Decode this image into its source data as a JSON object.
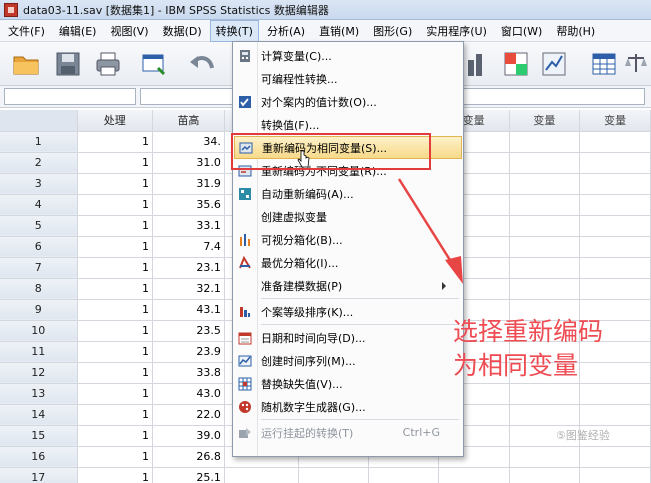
{
  "window": {
    "title": "data03-11.sav [数据集1] - IBM SPSS Statistics 数据编辑器"
  },
  "menubar": [
    {
      "label": "文件(F)",
      "name": "menu-file"
    },
    {
      "label": "编辑(E)",
      "name": "menu-edit"
    },
    {
      "label": "视图(V)",
      "name": "menu-view"
    },
    {
      "label": "数据(D)",
      "name": "menu-data"
    },
    {
      "label": "转换(T)",
      "name": "menu-transform",
      "active": true
    },
    {
      "label": "分析(A)",
      "name": "menu-analyze"
    },
    {
      "label": "直销(M)",
      "name": "menu-direct-marketing"
    },
    {
      "label": "图形(G)",
      "name": "menu-graphs"
    },
    {
      "label": "实用程序(U)",
      "name": "menu-utilities"
    },
    {
      "label": "窗口(W)",
      "name": "menu-window"
    },
    {
      "label": "帮助(H)",
      "name": "menu-help"
    }
  ],
  "toolbar_icons": [
    "open-folder-icon",
    "save-icon",
    "print-icon",
    "dialog-recall-icon",
    "undo-icon",
    "chart-icon",
    "split-file-icon",
    "select-cases-icon",
    "value-labels-icon",
    "weight-cases-icon"
  ],
  "grid": {
    "columns": [
      "",
      "处理",
      "苗高",
      "",
      "",
      "",
      "变量",
      "变量",
      "变量"
    ],
    "rows": [
      {
        "n": "1",
        "a": "1",
        "b": "34."
      },
      {
        "n": "2",
        "a": "1",
        "b": "31.0"
      },
      {
        "n": "3",
        "a": "1",
        "b": "31.9"
      },
      {
        "n": "4",
        "a": "1",
        "b": "35.6"
      },
      {
        "n": "5",
        "a": "1",
        "b": "33.1"
      },
      {
        "n": "6",
        "a": "1",
        "b": "7.4"
      },
      {
        "n": "7",
        "a": "1",
        "b": "23.1"
      },
      {
        "n": "8",
        "a": "1",
        "b": "32.1"
      },
      {
        "n": "9",
        "a": "1",
        "b": "43.1"
      },
      {
        "n": "10",
        "a": "1",
        "b": "23.5"
      },
      {
        "n": "11",
        "a": "1",
        "b": "23.9"
      },
      {
        "n": "12",
        "a": "1",
        "b": "33.8"
      },
      {
        "n": "13",
        "a": "1",
        "b": "43.0"
      },
      {
        "n": "14",
        "a": "1",
        "b": "22.0"
      },
      {
        "n": "15",
        "a": "1",
        "b": "39.0"
      },
      {
        "n": "16",
        "a": "1",
        "b": "26.8"
      },
      {
        "n": "17",
        "a": "1",
        "b": "25.1"
      }
    ]
  },
  "transform_menu": {
    "items": [
      {
        "label": "计算变量(C)...",
        "icon": "calculator-icon",
        "name": "menu-compute-variable"
      },
      {
        "label": "可编程性转换...",
        "icon": "",
        "name": "menu-programmability-transform"
      },
      {
        "label": "对个案内的值计数(O)...",
        "icon": "count-values-icon",
        "name": "menu-count-values"
      },
      {
        "label": "转换值(F)...",
        "icon": "",
        "name": "menu-shift-values"
      },
      {
        "label": "重新编码为相同变量(S)...",
        "icon": "recode-same-icon",
        "name": "menu-recode-same-variables",
        "highlighted": true
      },
      {
        "label": "重新编码为不同变量(R)...",
        "icon": "recode-different-icon",
        "name": "menu-recode-different-variables"
      },
      {
        "label": "自动重新编码(A)...",
        "icon": "automatic-recode-icon",
        "name": "menu-automatic-recode"
      },
      {
        "label": "创建虚拟变量",
        "icon": "",
        "name": "menu-create-dummy-variables"
      },
      {
        "label": "可视分箱化(B)...",
        "icon": "visual-binning-icon",
        "name": "menu-visual-binning"
      },
      {
        "label": "最优分箱化(I)...",
        "icon": "optimal-binning-icon",
        "name": "menu-optimal-binning"
      },
      {
        "label": "准备建模数据(P)",
        "icon": "",
        "name": "menu-prepare-data-modeling",
        "submenu": true
      },
      {
        "label": "个案等级排序(K)...",
        "icon": "rank-cases-icon",
        "name": "menu-rank-cases",
        "sep_before": true
      },
      {
        "label": "日期和时间向导(D)...",
        "icon": "date-time-wizard-icon",
        "name": "menu-date-time-wizard",
        "sep_before": true
      },
      {
        "label": "创建时间序列(M)...",
        "icon": "time-series-icon",
        "name": "menu-create-time-series"
      },
      {
        "label": "替换缺失值(V)...",
        "icon": "replace-missing-icon",
        "name": "menu-replace-missing-values"
      },
      {
        "label": "随机数字生成器(G)...",
        "icon": "random-number-icon",
        "name": "menu-random-number-generators"
      },
      {
        "label": "运行挂起的转换(T)",
        "icon": "run-pending-icon",
        "name": "menu-run-pending-transforms",
        "disabled": true,
        "shortcut": "Ctrl+G",
        "sep_before": true
      }
    ]
  },
  "annotation": {
    "line1": "选择重新编码",
    "line2": "为相同变量"
  },
  "watermark": "⑤图鉴经验"
}
